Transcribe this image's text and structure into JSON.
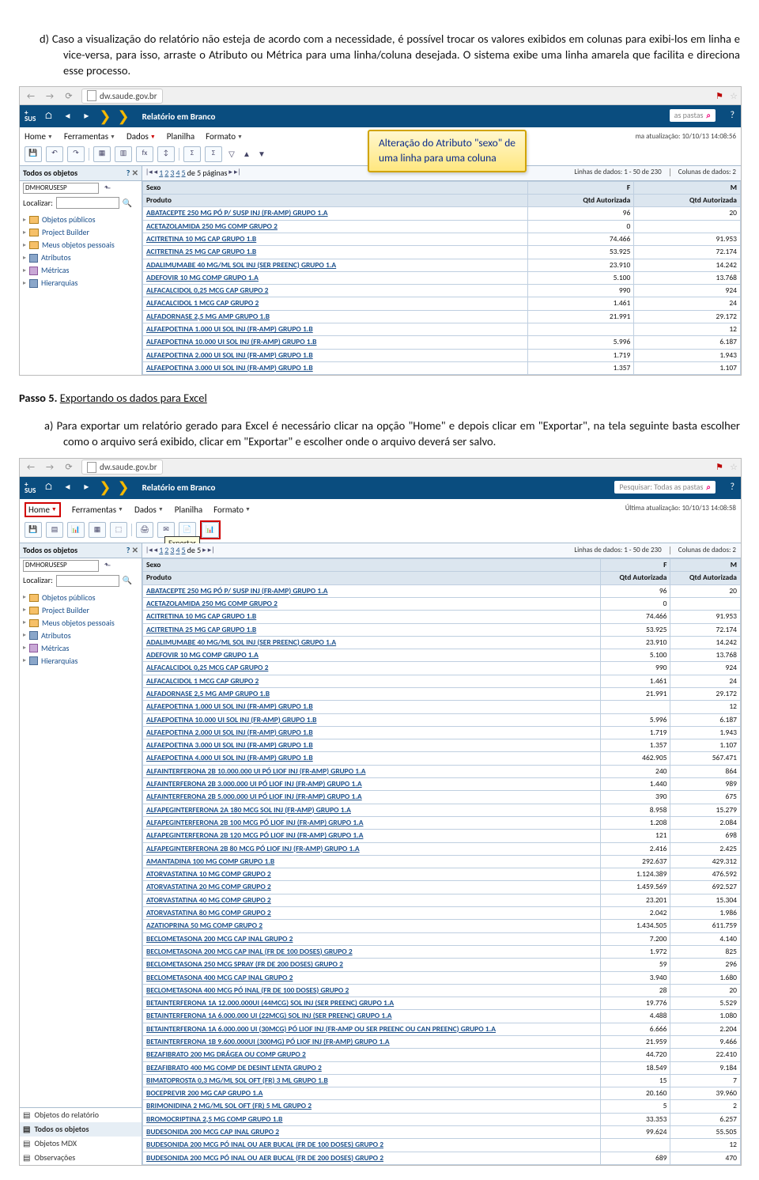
{
  "doc": {
    "para_d": "d) Caso a visualização do relatório não esteja de acordo com a necessidade, é possível trocar os valores exibidos em colunas para exibi-los em linha e vice-versa, para isso, arraste o Atributo ou Métrica para uma linha/coluna desejada. O sistema exibe uma linha amarela que facilita e direciona esse processo.",
    "step5_label": "Passo 5. ",
    "step5_title": "Exportando os dados para Excel",
    "para_a": "a) Para exportar um relatório gerado para Excel é necessário clicar na opção \"Home\" e depois clicar em \"Exportar\", na tela seguinte basta escolher como o arquivo será exibido, clicar em \"Exportar\" e escolher onde o arquivo deverá ser salvo."
  },
  "callout": {
    "line1": "Alteração do Atributo \"sexo\" de",
    "line2": "uma linha para uma coluna"
  },
  "browser": {
    "url": "dw.saude.gov.br"
  },
  "sus": {
    "logo_top": "+",
    "logo_bot": "SUS",
    "crumb": "Relatório em Branco",
    "search_ph": "Pesquisar: Todas as pastas",
    "search_ph_short": "as pastas"
  },
  "menu": {
    "home": "Home",
    "ferr": "Ferramentas",
    "dados": "Dados",
    "planilha": "Planilha",
    "formato": "Formato",
    "last_update_1": "ma atualização: 10/10/13 14:08:56",
    "last_update_2": "Última atualização: 10/10/13 14:08:58"
  },
  "exportar_tip": "Exportar",
  "sidebar": {
    "head": "Todos os objetos",
    "project": "DMHORUSESP",
    "localizar": "Localizar:",
    "tree": [
      "Objetos públicos",
      "Project Builder",
      "Meus objetos pessoais",
      "Atributos",
      "Métricas",
      "Hierarquias"
    ],
    "bottom": [
      "Objetos do relatório",
      "Todos os objetos",
      "Objetos MDX",
      "Observações"
    ]
  },
  "pager": {
    "pages_text": "de 5 páginas",
    "pages_text2": "de 5",
    "rows_info": "Linhas de dados: 1 - 50 de 230",
    "cols_info": "Colunas de dados: 2"
  },
  "grid": {
    "sexo": "Sexo",
    "produto": "Produto",
    "col_f": "F",
    "col_m": "M",
    "qtd": "Qtd Autorizada",
    "rows1": [
      {
        "p": "ABATACEPTE 250 MG PÓ P/ SUSP INJ (FR-AMP)   GRUPO 1.A",
        "f": "96",
        "m": "20"
      },
      {
        "p": "ACETAZOLAMIDA 250 MG COMP   GRUPO 2",
        "f": "0",
        "m": ""
      },
      {
        "p": "ACITRETINA 10 MG CAP   GRUPO 1.B",
        "f": "74.466",
        "m": "91.953"
      },
      {
        "p": "ACITRETINA 25 MG CAP   GRUPO 1.B",
        "f": "53.925",
        "m": "72.174"
      },
      {
        "p": "ADALIMUMABE 40 MG/ML SOL INJ (SER PREENC)   GRUPO 1.A",
        "f": "23.910",
        "m": "14.242"
      },
      {
        "p": "ADEFOVIR 10 MG COMP   GRUPO 1.A",
        "f": "5.100",
        "m": "13.768"
      },
      {
        "p": "ALFACALCIDOL 0,25 MCG CAP   GRUPO 2",
        "f": "990",
        "m": "924"
      },
      {
        "p": "ALFACALCIDOL 1 MCG CAP   GRUPO 2",
        "f": "1.461",
        "m": "24"
      },
      {
        "p": "ALFADORNASE 2,5 MG AMP   GRUPO 1.B",
        "f": "21.991",
        "m": "29.172"
      },
      {
        "p": "ALFAEPOETINA 1.000 UI SOL INJ (FR-AMP)   GRUPO 1.B",
        "f": "",
        "m": "12"
      },
      {
        "p": "ALFAEPOETINA 10.000 UI SOL INJ (FR-AMP)   GRUPO 1.B",
        "f": "5.996",
        "m": "6.187"
      },
      {
        "p": "ALFAEPOETINA 2.000 UI SOL INJ (FR-AMP)   GRUPO 1.B",
        "f": "1.719",
        "m": "1.943"
      },
      {
        "p": "ALFAEPOETINA 3.000 UI SOL INJ (FR-AMP)   GRUPO 1.B",
        "f": "1.357",
        "m": "1.107"
      }
    ],
    "rows2": [
      {
        "p": "ABATACEPTE 250 MG PÓ P/ SUSP INJ (FR-AMP)   GRUPO 1.A",
        "f": "96",
        "m": "20"
      },
      {
        "p": "ACETAZOLAMIDA 250 MG COMP   GRUPO 2",
        "f": "0",
        "m": ""
      },
      {
        "p": "ACITRETINA 10 MG CAP   GRUPO 1.B",
        "f": "74.466",
        "m": "91.953"
      },
      {
        "p": "ACITRETINA 25 MG CAP   GRUPO 1.B",
        "f": "53.925",
        "m": "72.174"
      },
      {
        "p": "ADALIMUMABE 40 MG/ML SOL INJ (SER PREENC)   GRUPO 1.A",
        "f": "23.910",
        "m": "14.242"
      },
      {
        "p": "ADEFOVIR 10 MG COMP   GRUPO 1.A",
        "f": "5.100",
        "m": "13.768"
      },
      {
        "p": "ALFACALCIDOL 0,25 MCG CAP   GRUPO 2",
        "f": "990",
        "m": "924"
      },
      {
        "p": "ALFACALCIDOL 1 MCG CAP   GRUPO 2",
        "f": "1.461",
        "m": "24"
      },
      {
        "p": "ALFADORNASE 2,5 MG AMP   GRUPO 1.B",
        "f": "21.991",
        "m": "29.172"
      },
      {
        "p": "ALFAEPOETINA 1.000 UI SOL INJ (FR-AMP)   GRUPO 1.B",
        "f": "",
        "m": "12"
      },
      {
        "p": "ALFAEPOETINA 10.000 UI SOL INJ (FR-AMP)   GRUPO 1.B",
        "f": "5.996",
        "m": "6.187"
      },
      {
        "p": "ALFAEPOETINA 2.000 UI SOL INJ (FR-AMP)   GRUPO 1.B",
        "f": "1.719",
        "m": "1.943"
      },
      {
        "p": "ALFAEPOETINA 3.000 UI SOL INJ (FR-AMP)   GRUPO 1.B",
        "f": "1.357",
        "m": "1.107"
      },
      {
        "p": "ALFAEPOETINA 4.000 UI SOL INJ (FR-AMP)   GRUPO 1.B",
        "f": "462.905",
        "m": "567.471"
      },
      {
        "p": "ALFAINTERFERONA 2B 10.000.000 UI PÓ LIOF INJ (FR-AMP)   GRUPO 1.A",
        "f": "240",
        "m": "864"
      },
      {
        "p": "ALFAINTERFERONA 2B 3.000.000 UI PÓ LIOF INJ (FR-AMP)   GRUPO 1.A",
        "f": "1.440",
        "m": "989"
      },
      {
        "p": "ALFAINTERFERONA 2B 5.000.000 UI PÓ LIOF INJ (FR-AMP)   GRUPO 1.A",
        "f": "390",
        "m": "675"
      },
      {
        "p": "ALFAPEGINTERFERONA 2A 180 MCG SOL INJ (FR-AMP)   GRUPO 1.A",
        "f": "8.958",
        "m": "15.279"
      },
      {
        "p": "ALFAPEGINTERFERONA 2B 100 MCG PÓ LIOF INJ (FR-AMP)   GRUPO 1.A",
        "f": "1.208",
        "m": "2.084"
      },
      {
        "p": "ALFAPEGINTERFERONA 2B 120 MCG PÓ LIOF INJ (FR-AMP)   GRUPO 1.A",
        "f": "121",
        "m": "698"
      },
      {
        "p": "ALFAPEGINTERFERONA 2B 80 MCG PÓ LIOF INJ (FR-AMP)   GRUPO 1.A",
        "f": "2.416",
        "m": "2.425"
      },
      {
        "p": "AMANTADINA 100 MG COMP   GRUPO 1.B",
        "f": "292.637",
        "m": "429.312"
      },
      {
        "p": "ATORVASTATINA 10 MG COMP   GRUPO 2",
        "f": "1.124.389",
        "m": "476.592"
      },
      {
        "p": "ATORVASTATINA 20 MG COMP   GRUPO 2",
        "f": "1.459.569",
        "m": "692.527"
      },
      {
        "p": "ATORVASTATINA 40 MG COMP   GRUPO 2",
        "f": "23.201",
        "m": "15.304"
      },
      {
        "p": "ATORVASTATINA 80 MG COMP   GRUPO 2",
        "f": "2.042",
        "m": "1.986"
      },
      {
        "p": "AZATIOPRINA 50 MG COMP   GRUPO 2",
        "f": "1.434.505",
        "m": "611.759"
      },
      {
        "p": "BECLOMETASONA 200 MCG CAP INAL   GRUPO 2",
        "f": "7.200",
        "m": "4.140"
      },
      {
        "p": "BECLOMETASONA 200 MCG CAP INAL (FR DE 100 DOSES)   GRUPO 2",
        "f": "1.972",
        "m": "825"
      },
      {
        "p": "BECLOMETASONA 250 MCG SPRAY (FR DE 200 DOSES)   GRUPO 2",
        "f": "59",
        "m": "296"
      },
      {
        "p": "BECLOMETASONA 400 MCG CAP INAL   GRUPO 2",
        "f": "3.940",
        "m": "1.680"
      },
      {
        "p": "BECLOMETASONA 400 MCG PÓ INAL (FR DE 100 DOSES)   GRUPO 2",
        "f": "28",
        "m": "20"
      },
      {
        "p": "BETAINTERFERONA 1A 12.000.000UI (44MCG)  SOL INJ (SER PREENC)   GRUPO 1.A",
        "f": "19.776",
        "m": "5.529"
      },
      {
        "p": "BETAINTERFERONA 1A 6.000.000 UI (22MCG) SOL INJ (SER PREENC)   GRUPO 1.A",
        "f": "4.488",
        "m": "1.080"
      },
      {
        "p": "BETAINTERFERONA 1A 6.000.000 UI (30MCG)  PÓ LIOF INJ (FR-AMP OU SER PREENC OU CAN PREENC)   GRUPO 1.A",
        "f": "6.666",
        "m": "2.204"
      },
      {
        "p": "BETAINTERFERONA 1B 9.600.000UI (300MG)  PÓ LIOF INJ (FR-AMP)   GRUPO 1.A",
        "f": "21.959",
        "m": "9.466"
      },
      {
        "p": "BEZAFIBRATO 200 MG DRÁGEA OU COMP   GRUPO 2",
        "f": "44.720",
        "m": "22.410"
      },
      {
        "p": "BEZAFIBRATO 400 MG COMP DE DESINT LENTA   GRUPO 2",
        "f": "18.549",
        "m": "9.184"
      },
      {
        "p": "BIMATOPROSTA 0,3 MG/ML SOL OFT (FR) 3 ML GRUPO 1.B",
        "f": "15",
        "m": "7"
      },
      {
        "p": "BOCEPREVIR 200 MG CAP   GRUPO 1.A",
        "f": "20.160",
        "m": "39.960"
      },
      {
        "p": "BRIMONIDINA 2 MG/ML SOL OFT (FR) 5 ML GRUPO 2",
        "f": "5",
        "m": "2"
      },
      {
        "p": "BROMOCRIPTINA 2,5 MG COMP   GRUPO 1.B",
        "f": "33.353",
        "m": "6.257"
      },
      {
        "p": "BUDESONIDA 200 MCG CAP INAL   GRUPO 2",
        "f": "99.624",
        "m": "55.505"
      },
      {
        "p": "BUDESONIDA 200 MCG PÓ INAL OU AER BUCAL (FR DE 100 DOSES)   GRUPO 2",
        "f": "",
        "m": "12"
      },
      {
        "p": "BUDESONIDA 200 MCG PÓ INAL OU AER BUCAL (FR DE 200 DOSES)   GRUPO 2",
        "f": "689",
        "m": "470"
      }
    ]
  }
}
